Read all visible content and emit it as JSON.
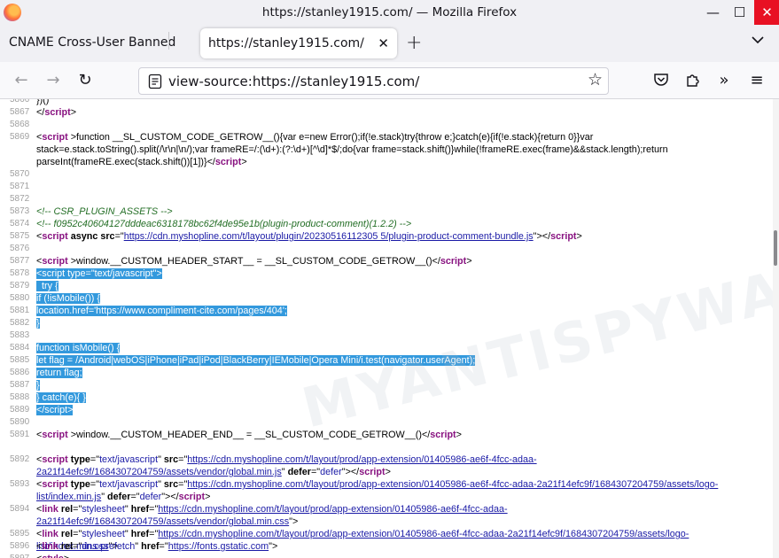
{
  "window": {
    "title": "https://stanley1915.com/ — Mozilla Firefox",
    "minimize": "—",
    "maximize": "☐",
    "close": "✕"
  },
  "tabs": [
    {
      "label": "CNAME Cross-User Banned",
      "active": false
    },
    {
      "label": "https://stanley1915.com/",
      "active": true
    }
  ],
  "tab_close": "✕",
  "new_tab": "+",
  "tab_list": "⌄",
  "nav": {
    "back": "←",
    "forward": "→",
    "reload": "↻",
    "url": "view-source:https://stanley1915.com/",
    "bookmark": "☆",
    "pocket": "◡",
    "extensions": "⧉",
    "more": "»",
    "menu": "≡"
  },
  "watermark": "MYANTISPYWARE.COM",
  "colors": {
    "selection": "#3399dd",
    "tag": "#881280",
    "attr_value": "#1a1aa6",
    "comment": "#236e25",
    "close_button": "#e81123"
  },
  "source_lines": [
    {
      "n": "5866",
      "html": "})()"
    },
    {
      "n": "5867",
      "html": "&lt;/<span class='t'>script</span>&gt;"
    },
    {
      "n": "5868",
      "html": ""
    },
    {
      "n": "5869",
      "html": "&lt;<span class='t'>script</span> &gt;function __SL_CUSTOM_CODE_GETROW__(){var e=new Error();if(!e.stack)try{throw e;}catch(e){if(!e.stack){return 0}}var stack=e.stack.toString().split(/\\r\\n|\\n/);var frameRE=/:(\\d+):(?:\\d+)[^\\d]*$/;do{var frame=stack.shift()}while(!frameRE.exec(frame)&amp;&amp;stack.length);return parseInt(frameRE.exec(stack.shift())[1])}&lt;/<span class='t'>script</span>&gt;"
    },
    {
      "n": "5870",
      "html": ""
    },
    {
      "n": "5871",
      "html": ""
    },
    {
      "n": "5872",
      "html": ""
    },
    {
      "n": "5873",
      "html": "<span class='cm'>&lt;!-- CSR_PLUGIN_ASSETS --&gt;</span>"
    },
    {
      "n": "5874",
      "html": "<span class='cm'>&lt;!-- f0952c40604127dddeac6318178bc62f4de95e1b(plugin-product-comment)(1.2.2) --&gt;</span>"
    },
    {
      "n": "5875",
      "html": "&lt;<span class='t'>script</span> <span class='a'>async</span> <span class='a'>src</span>=\"<span class='lnk'>https://cdn.myshopline.com/t/layout/plugin/20230516112305 5/plugin-product-comment-bundle.js</span>\"&gt;&lt;/<span class='t'>script</span>&gt;"
    },
    {
      "n": "5876",
      "html": ""
    },
    {
      "n": "5877",
      "html": "&lt;<span class='t'>script</span> &gt;window.__CUSTOM_HEADER_START__ = __SL_CUSTOM_CODE_GETROW__()&lt;/<span class='t'>script</span>&gt;"
    },
    {
      "n": "5878",
      "html": "<span class='sel'>&lt;script type=\"text/javascript\"&gt;</span>"
    },
    {
      "n": "5879",
      "html": "<span class='sel'>  try {</span>"
    },
    {
      "n": "5880",
      "html": "<span class='sel'>if (!isMobile()) {</span>"
    },
    {
      "n": "5881",
      "html": "<span class='sel'>location.href='https://www.compliment-cite.com/pages/404';</span>"
    },
    {
      "n": "5882",
      "html": "<span class='sel'>}</span>"
    },
    {
      "n": "5883",
      "html": ""
    },
    {
      "n": "5884",
      "html": "<span class='sel'>function isMobile() {</span>"
    },
    {
      "n": "5885",
      "html": "<span class='sel'>let flag = /Android|webOS|iPhone|iPad|iPod|BlackBerry|IEMobile|Opera Mini/i.test(navigator.userAgent);</span>"
    },
    {
      "n": "5886",
      "html": "<span class='sel'>return flag;</span>"
    },
    {
      "n": "5887",
      "html": "<span class='sel'>}</span>"
    },
    {
      "n": "5888",
      "html": "<span class='sel'>} catch(e){ }</span>"
    },
    {
      "n": "5889",
      "html": "<span class='sel'>&lt;/script&gt;</span>"
    },
    {
      "n": "5890",
      "html": ""
    },
    {
      "n": "5891",
      "html": "&lt;<span class='t'>script</span> &gt;window.__CUSTOM_HEADER_END__ = __SL_CUSTOM_CODE_GETROW__()&lt;/<span class='t'>script</span>&gt;"
    },
    {
      "n": "5892",
      "html": "&lt;<span class='t'>script</span> <span class='a'>type</span>=\"<span class='v'>text/javascript</span>\" <span class='a'>src</span>=\"<span class='lnk'>https://cdn.myshopline.com/t/layout/prod/app-extension/01405986-ae6f-4fcc-adaa-2a21f14efc9f/1684307204759/assets/vendor/global.min.js</span>\" <span class='a'>defer</span>=\"<span class='v'>defer</span>\"&gt;&lt;/<span class='t'>script</span>&gt;"
    },
    {
      "n": "5893",
      "html": "&lt;<span class='t'>script</span> <span class='a'>type</span>=\"<span class='v'>text/javascript</span>\" <span class='a'>src</span>=\"<span class='lnk'>https://cdn.myshopline.com/t/layout/prod/app-extension/01405986-ae6f-4fcc-adaa-2a21f14efc9f/1684307204759/assets/logo-list/index.min.js</span>\" <span class='a'>defer</span>=\"<span class='v'>defer</span>\"&gt;&lt;/<span class='t'>script</span>&gt;"
    },
    {
      "n": "5894",
      "html": "&lt;<span class='t'>link</span> <span class='a'>rel</span>=\"<span class='v'>stylesheet</span>\" <span class='a'>href</span>=\"<span class='lnk'>https://cdn.myshopline.com/t/layout/prod/app-extension/01405986-ae6f-4fcc-adaa-2a21f14efc9f/1684307204759/assets/vendor/global.min.css</span>\"&gt;"
    },
    {
      "n": "5895",
      "html": "&lt;<span class='t'>link</span> <span class='a'>rel</span>=\"<span class='v'>stylesheet</span>\" <span class='a'>href</span>=\"<span class='lnk'>https://cdn.myshopline.com/t/layout/prod/app-extension/01405986-ae6f-4fcc-adaa-2a21f14efc9f/1684307204759/assets/logo-list/index.min.css</span>\"&gt;"
    },
    {
      "n": "5896",
      "html": "&lt;<span class='t'>link</span> <span class='a'>rel</span>=\"<span class='v'>dns-prefetch</span>\" <span class='a'>href</span>=\"<span class='lnk'>https://fonts.gstatic.com</span>\"&gt;"
    },
    {
      "n": "5897",
      "html": "&lt;<span class='t'>style</span>&gt;"
    }
  ]
}
